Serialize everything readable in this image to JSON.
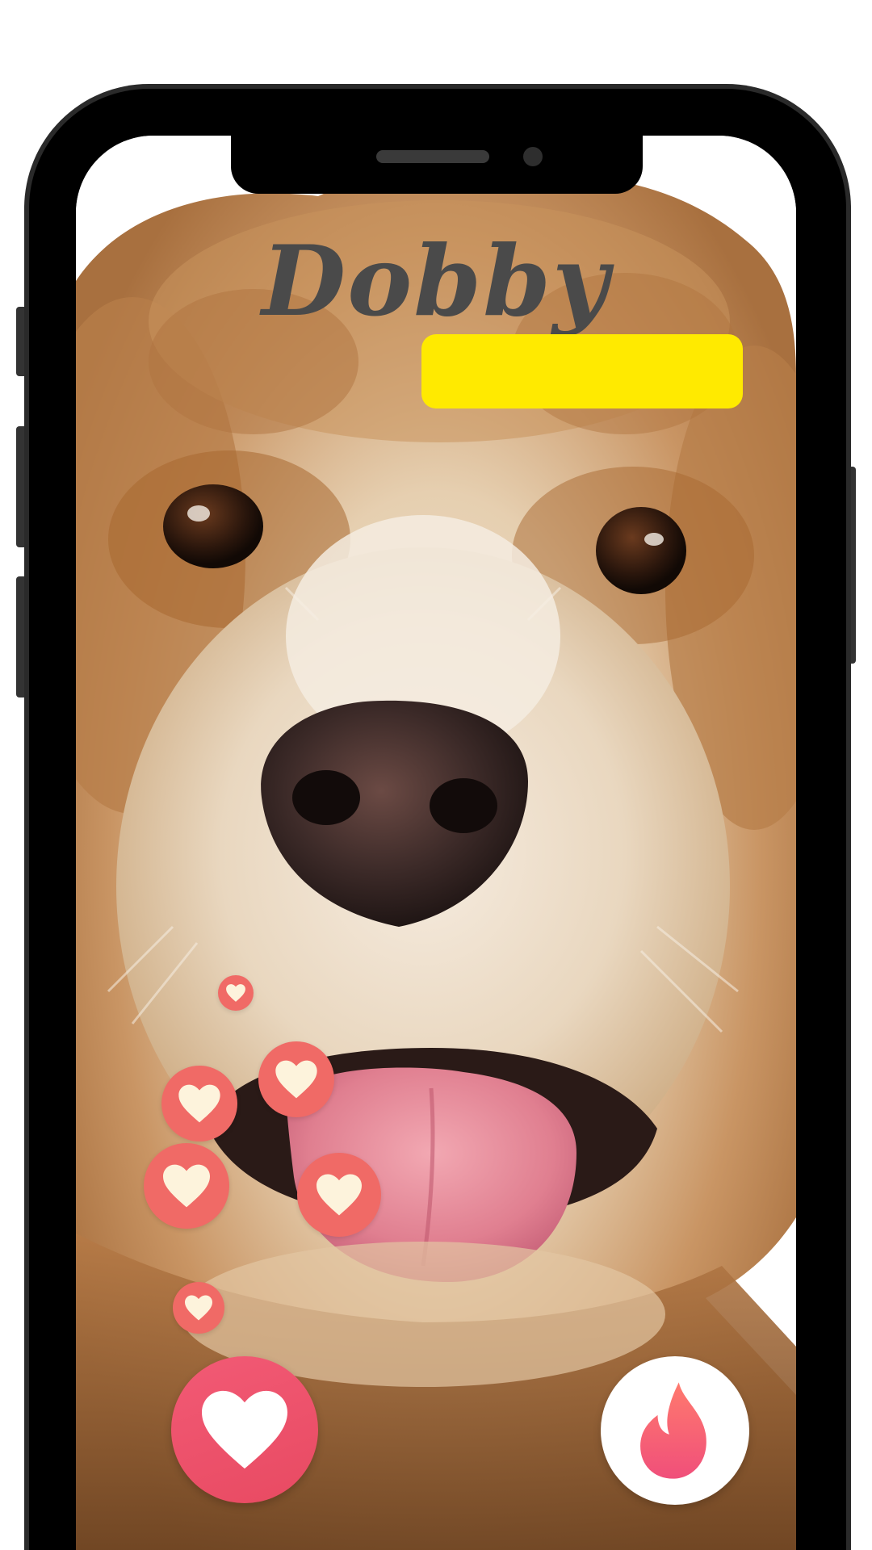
{
  "profile": {
    "name": "Dobby"
  },
  "colors": {
    "name_text": "#4a4a4a",
    "highlight_bar": "#ffea00",
    "heart_bubble": "#f06a66",
    "heart_fill": "#fdf3dc",
    "like_button": "#ee5470",
    "fire_gradient_top": "#ff7a6e",
    "fire_gradient_bottom": "#f04f7a"
  },
  "icons": {
    "like": "heart-icon",
    "boost": "flame-icon",
    "floating": "heart-icon"
  }
}
